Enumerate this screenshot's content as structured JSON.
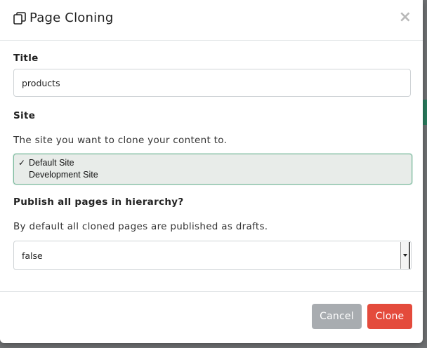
{
  "dialog": {
    "title": "Page Cloning",
    "close_symbol": "×",
    "header_icon": "copy-icon"
  },
  "fields": {
    "title": {
      "label": "Title",
      "value": "products"
    },
    "site": {
      "label": "Site",
      "help": "The site you want to clone your content to.",
      "options": [
        "Default Site",
        "Development Site"
      ],
      "selected": "Default Site",
      "check_symbol": "✓"
    },
    "publish": {
      "label": "Publish all pages in hierarchy?",
      "help": "By default all cloned pages are published as drafts.",
      "value": "false"
    }
  },
  "footer": {
    "cancel_label": "Cancel",
    "clone_label": "Clone",
    "cancel_color": "#a8acb0",
    "clone_color": "#e44b3c"
  }
}
